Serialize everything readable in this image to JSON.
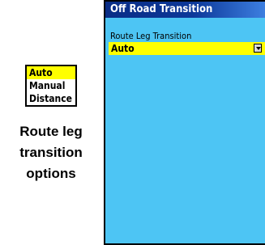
{
  "options_list": {
    "items": [
      "Auto",
      "Manual",
      "Distance"
    ],
    "selected": "Auto"
  },
  "caption": {
    "line1": "Route leg",
    "line2": "transition",
    "line3": "options"
  },
  "screen": {
    "title": "Off Road Transition",
    "field_label": "Route Leg Transition",
    "field_value": "Auto",
    "colors": {
      "background": "#4dc5f4",
      "title_bar": "#0c3899",
      "highlight": "#ffff00"
    }
  }
}
